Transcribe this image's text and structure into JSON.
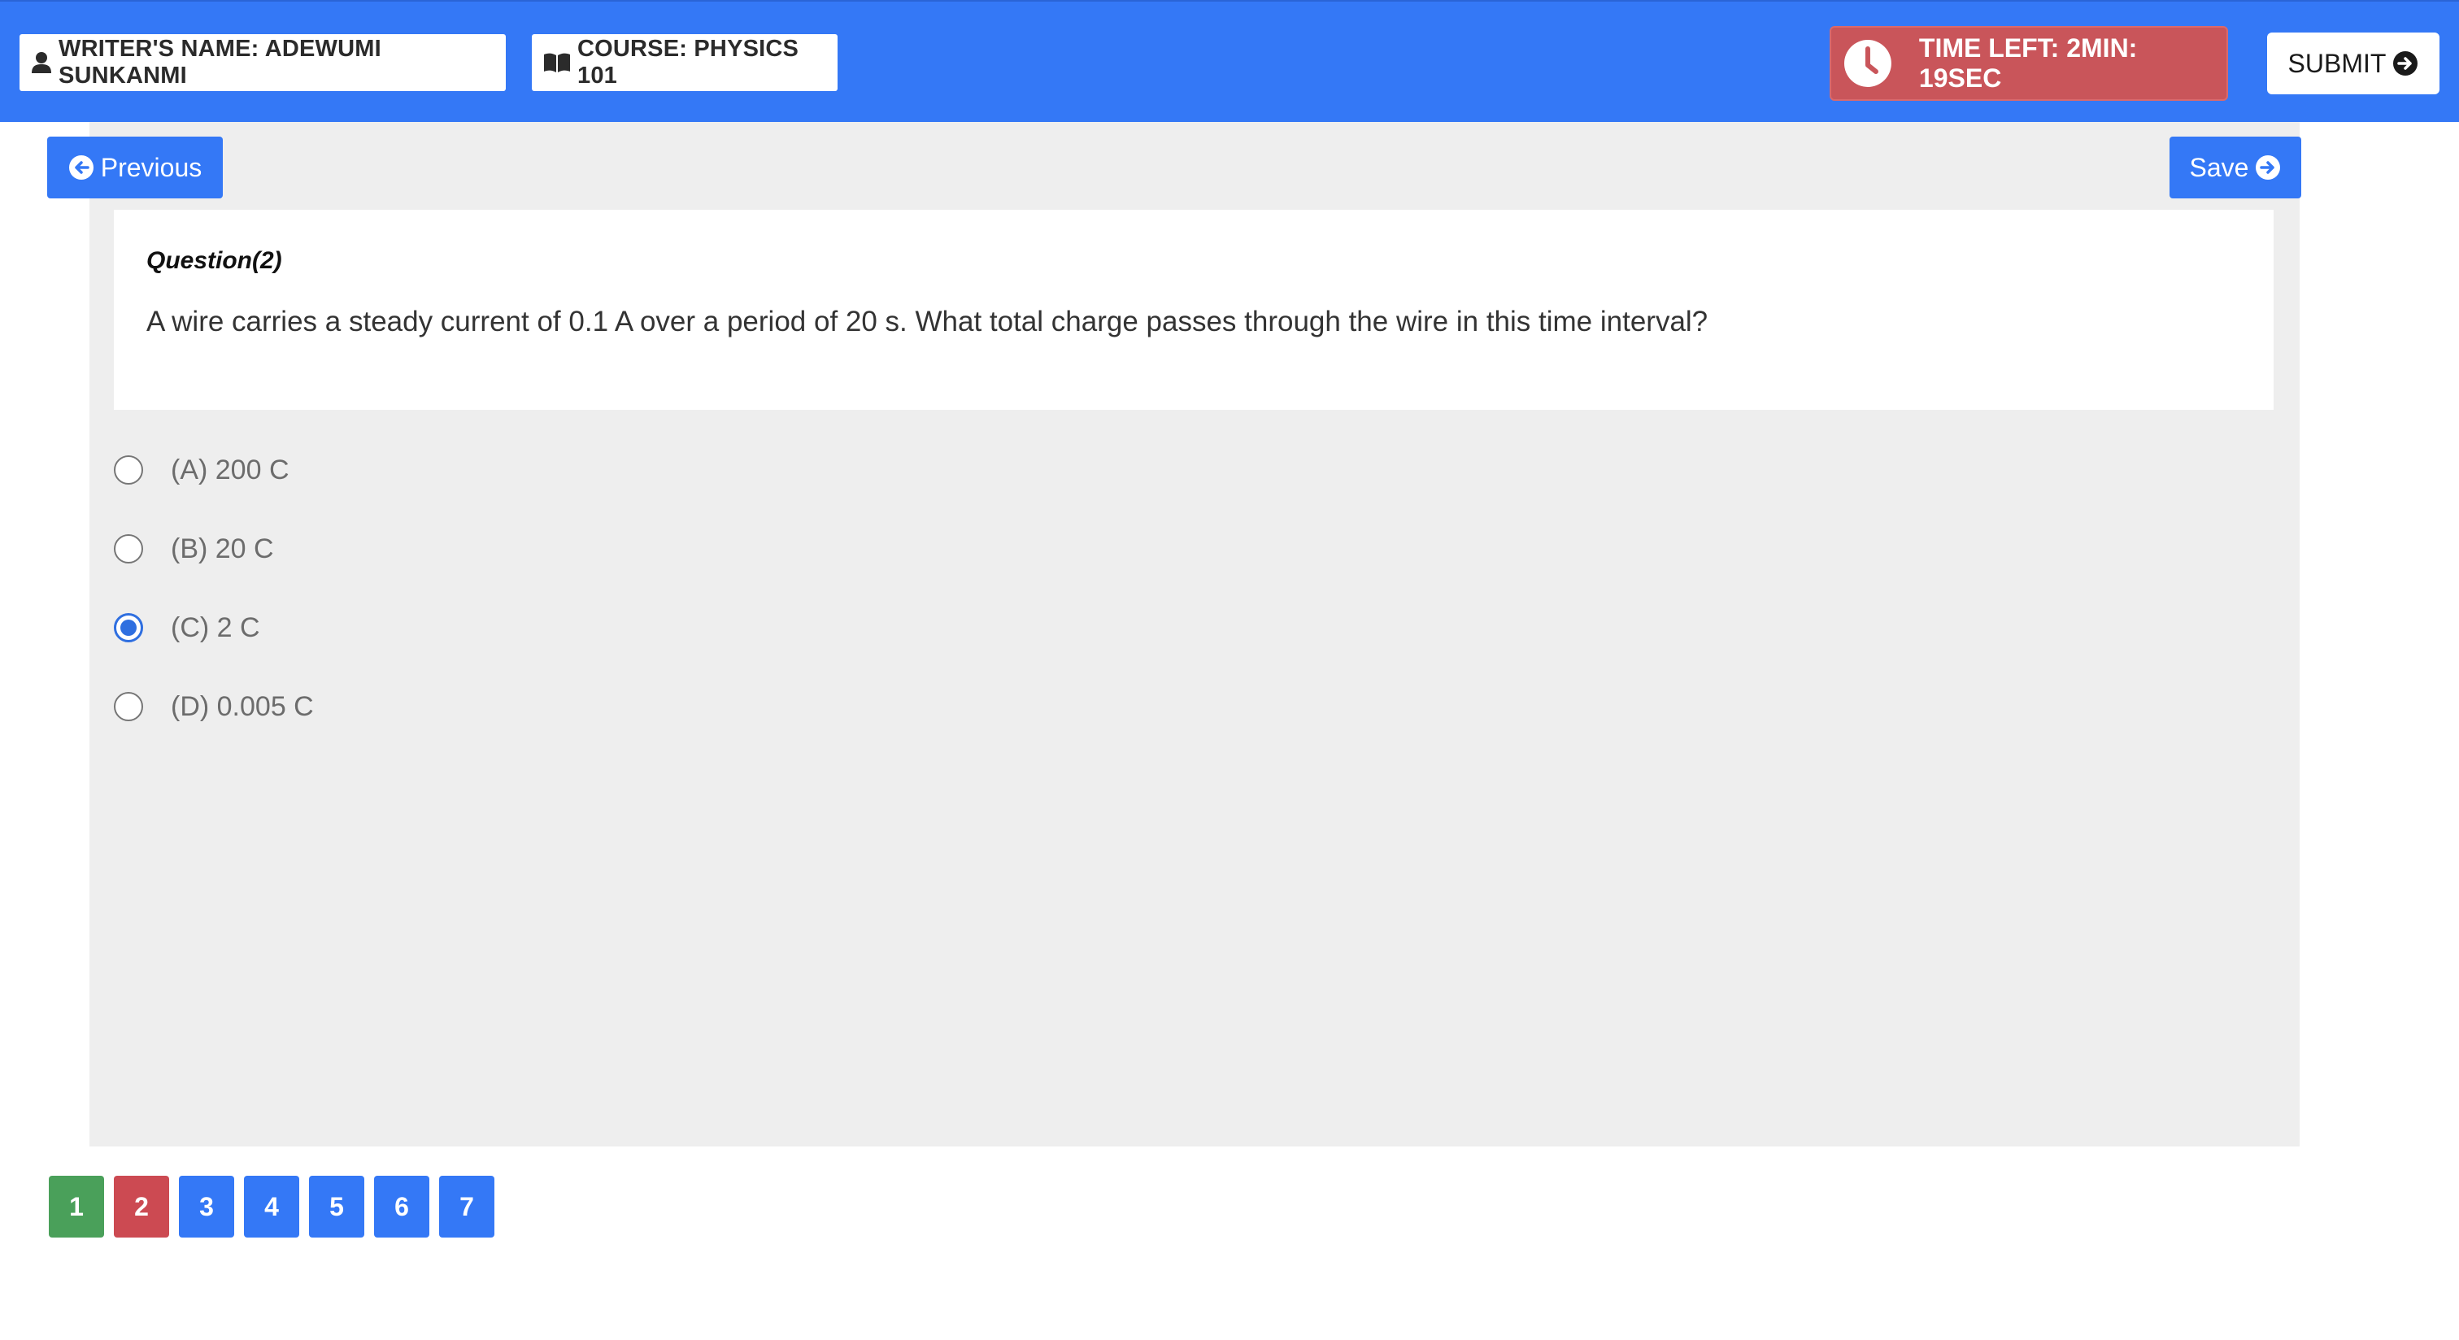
{
  "header": {
    "writer_label": "WRITER'S NAME: ADEWUMI SUNKANMI",
    "course_label": "COURSE: PHYSICS 101",
    "timer_label": "TIME LEFT: 2MIN: 19SEC",
    "submit_label": "SUBMIT"
  },
  "nav": {
    "previous_label": "Previous",
    "save_label": "Save"
  },
  "question": {
    "title": "Question(2)",
    "text": "A wire carries a steady current of 0.1 A over a period of 20 s. What total charge passes through the wire in this time interval?",
    "options": [
      {
        "label": "(A) 200 C",
        "selected": false
      },
      {
        "label": "(B) 20 C",
        "selected": false
      },
      {
        "label": "(C) 2 C",
        "selected": true
      },
      {
        "label": "(D) 0.005 C",
        "selected": false
      }
    ]
  },
  "pagination": {
    "pages": [
      {
        "label": "1",
        "status": "answered",
        "color": "#4aa05a"
      },
      {
        "label": "2",
        "status": "current",
        "color": "#cc4a52"
      },
      {
        "label": "3",
        "status": "unanswered",
        "color": "#3478f6"
      },
      {
        "label": "4",
        "status": "unanswered",
        "color": "#3478f6"
      },
      {
        "label": "5",
        "status": "unanswered",
        "color": "#3478f6"
      },
      {
        "label": "6",
        "status": "unanswered",
        "color": "#3478f6"
      },
      {
        "label": "7",
        "status": "unanswered",
        "color": "#3478f6"
      }
    ]
  },
  "icons": {
    "writer": "user-icon",
    "course": "book-icon",
    "timer": "clock-icon",
    "submit": "arrow-circle-right-icon",
    "previous": "arrow-circle-left-icon",
    "save": "arrow-circle-right-icon"
  },
  "colors": {
    "primary": "#3478f6",
    "timer_bg": "#c9555a",
    "answered": "#4aa05a",
    "current": "#cc4a52",
    "panel_bg": "#eeeeee"
  }
}
